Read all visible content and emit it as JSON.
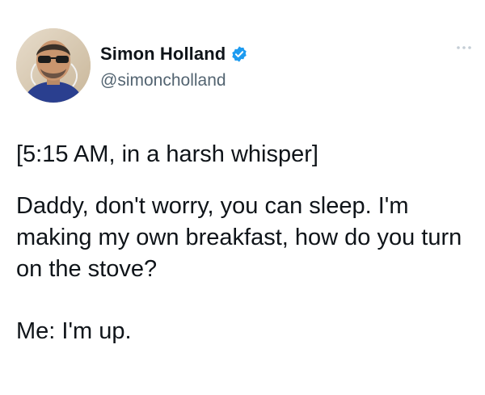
{
  "author": {
    "display_name": "Simon Holland",
    "handle": "@simoncholland",
    "verified": true,
    "avatar_icon": "profile-photo",
    "verified_icon": "verified-badge-icon",
    "verified_color": "#1d9bf0"
  },
  "menu": {
    "icon": "more-options-icon"
  },
  "tweet": {
    "paragraphs": [
      "[5:15 AM, in a harsh whisper]",
      "Daddy, don't worry, you can sleep. I'm making my own breakfast, how do you turn on the stove?",
      "Me: I'm up."
    ]
  },
  "colors": {
    "text": "#0f1419",
    "secondary": "#536471",
    "background": "#ffffff"
  }
}
